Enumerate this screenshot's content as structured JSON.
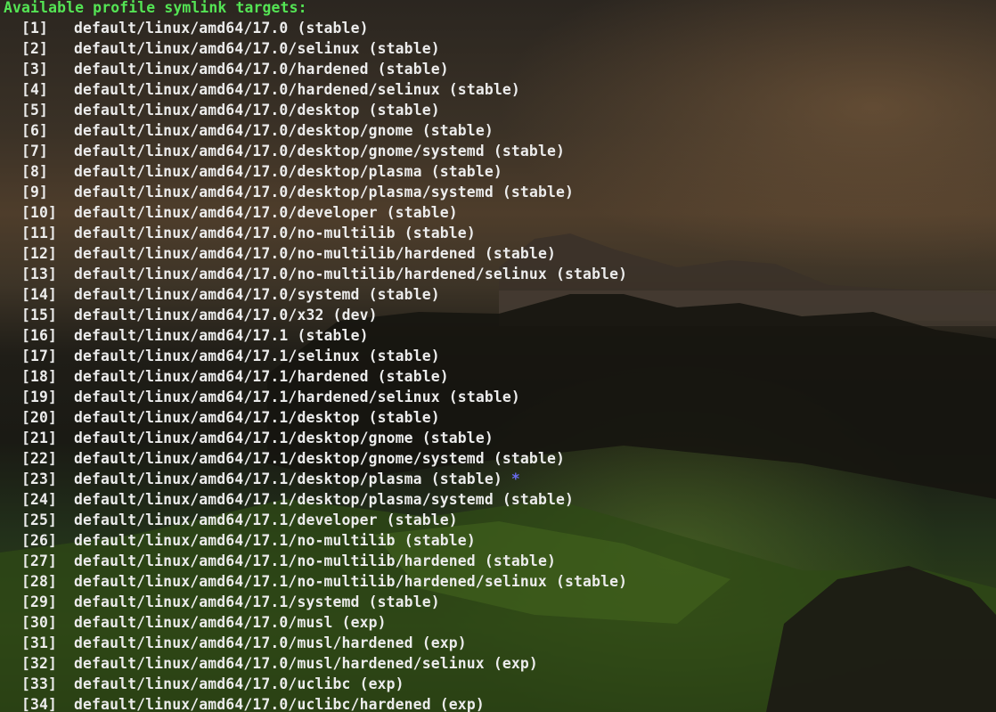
{
  "terminal": {
    "header": "Available profile symlink targets:",
    "current_marker": "*",
    "profiles": [
      {
        "index": "[1]",
        "path": "default/linux/amd64/17.0",
        "status": "(stable)"
      },
      {
        "index": "[2]",
        "path": "default/linux/amd64/17.0/selinux",
        "status": "(stable)"
      },
      {
        "index": "[3]",
        "path": "default/linux/amd64/17.0/hardened",
        "status": "(stable)"
      },
      {
        "index": "[4]",
        "path": "default/linux/amd64/17.0/hardened/selinux",
        "status": "(stable)"
      },
      {
        "index": "[5]",
        "path": "default/linux/amd64/17.0/desktop",
        "status": "(stable)"
      },
      {
        "index": "[6]",
        "path": "default/linux/amd64/17.0/desktop/gnome",
        "status": "(stable)"
      },
      {
        "index": "[7]",
        "path": "default/linux/amd64/17.0/desktop/gnome/systemd",
        "status": "(stable)"
      },
      {
        "index": "[8]",
        "path": "default/linux/amd64/17.0/desktop/plasma",
        "status": "(stable)"
      },
      {
        "index": "[9]",
        "path": "default/linux/amd64/17.0/desktop/plasma/systemd",
        "status": "(stable)"
      },
      {
        "index": "[10]",
        "path": "default/linux/amd64/17.0/developer",
        "status": "(stable)"
      },
      {
        "index": "[11]",
        "path": "default/linux/amd64/17.0/no-multilib",
        "status": "(stable)"
      },
      {
        "index": "[12]",
        "path": "default/linux/amd64/17.0/no-multilib/hardened",
        "status": "(stable)"
      },
      {
        "index": "[13]",
        "path": "default/linux/amd64/17.0/no-multilib/hardened/selinux",
        "status": "(stable)"
      },
      {
        "index": "[14]",
        "path": "default/linux/amd64/17.0/systemd",
        "status": "(stable)"
      },
      {
        "index": "[15]",
        "path": "default/linux/amd64/17.0/x32",
        "status": "(dev)"
      },
      {
        "index": "[16]",
        "path": "default/linux/amd64/17.1",
        "status": "(stable)"
      },
      {
        "index": "[17]",
        "path": "default/linux/amd64/17.1/selinux",
        "status": "(stable)"
      },
      {
        "index": "[18]",
        "path": "default/linux/amd64/17.1/hardened",
        "status": "(stable)"
      },
      {
        "index": "[19]",
        "path": "default/linux/amd64/17.1/hardened/selinux",
        "status": "(stable)"
      },
      {
        "index": "[20]",
        "path": "default/linux/amd64/17.1/desktop",
        "status": "(stable)"
      },
      {
        "index": "[21]",
        "path": "default/linux/amd64/17.1/desktop/gnome",
        "status": "(stable)"
      },
      {
        "index": "[22]",
        "path": "default/linux/amd64/17.1/desktop/gnome/systemd",
        "status": "(stable)"
      },
      {
        "index": "[23]",
        "path": "default/linux/amd64/17.1/desktop/plasma",
        "status": "(stable)",
        "current": true
      },
      {
        "index": "[24]",
        "path": "default/linux/amd64/17.1/desktop/plasma/systemd",
        "status": "(stable)"
      },
      {
        "index": "[25]",
        "path": "default/linux/amd64/17.1/developer",
        "status": "(stable)"
      },
      {
        "index": "[26]",
        "path": "default/linux/amd64/17.1/no-multilib",
        "status": "(stable)"
      },
      {
        "index": "[27]",
        "path": "default/linux/amd64/17.1/no-multilib/hardened",
        "status": "(stable)"
      },
      {
        "index": "[28]",
        "path": "default/linux/amd64/17.1/no-multilib/hardened/selinux",
        "status": "(stable)"
      },
      {
        "index": "[29]",
        "path": "default/linux/amd64/17.1/systemd",
        "status": "(stable)"
      },
      {
        "index": "[30]",
        "path": "default/linux/amd64/17.0/musl",
        "status": "(exp)"
      },
      {
        "index": "[31]",
        "path": "default/linux/amd64/17.0/musl/hardened",
        "status": "(exp)"
      },
      {
        "index": "[32]",
        "path": "default/linux/amd64/17.0/musl/hardened/selinux",
        "status": "(exp)"
      },
      {
        "index": "[33]",
        "path": "default/linux/amd64/17.0/uclibc",
        "status": "(exp)"
      },
      {
        "index": "[34]",
        "path": "default/linux/amd64/17.0/uclibc/hardened",
        "status": "(exp)"
      }
    ]
  },
  "colors": {
    "header": "#54e454",
    "text": "#ececec",
    "current_marker": "#6a6cf0"
  }
}
